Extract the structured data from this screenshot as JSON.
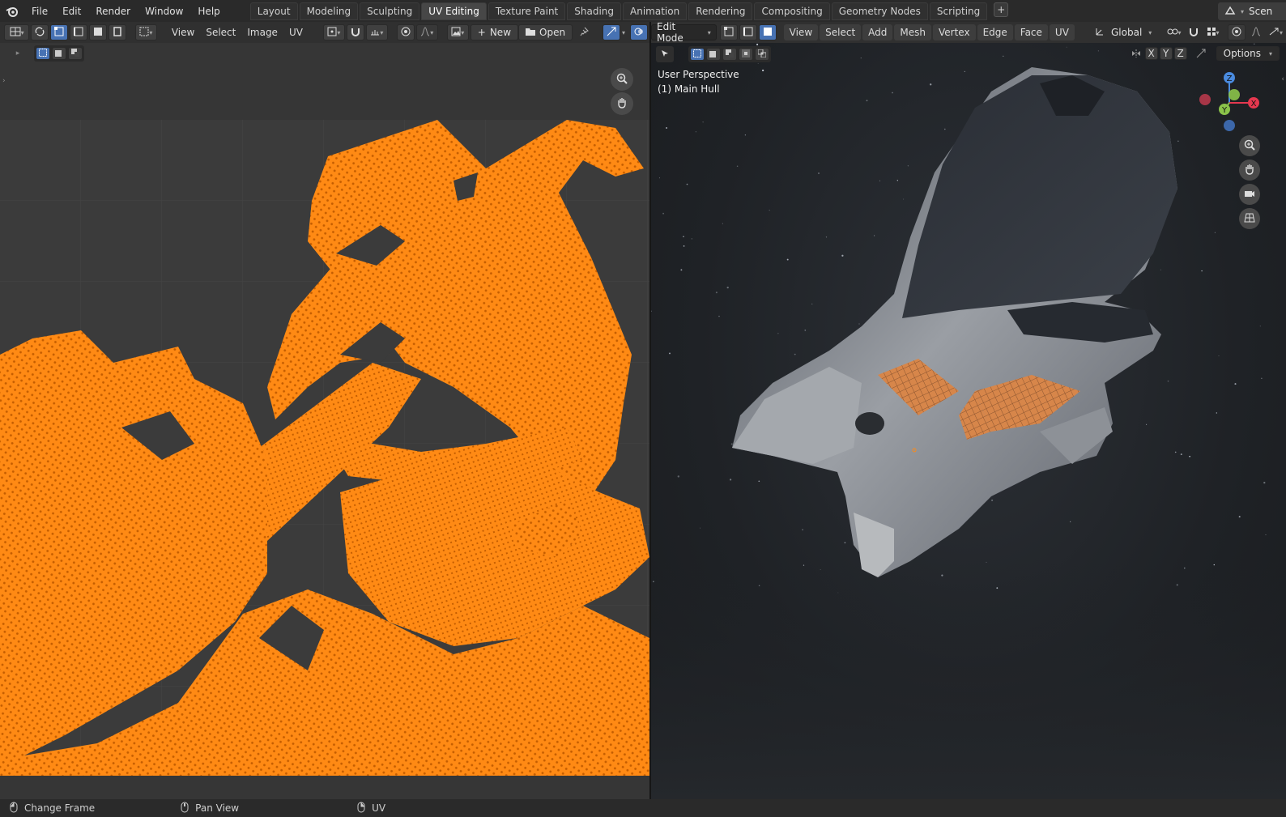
{
  "topbar": {
    "menus": [
      "File",
      "Edit",
      "Render",
      "Window",
      "Help"
    ],
    "tabs": [
      "Layout",
      "Modeling",
      "Sculpting",
      "UV Editing",
      "Texture Paint",
      "Shading",
      "Animation",
      "Rendering",
      "Compositing",
      "Geometry Nodes",
      "Scripting"
    ],
    "active_tab": "UV Editing",
    "scene_label": "Scen"
  },
  "uv_header": {
    "menus": [
      "View",
      "Select",
      "Image",
      "UV"
    ],
    "new_label": "New",
    "open_label": "Open"
  },
  "viewport_header": {
    "mode": "Edit Mode",
    "menus": [
      "View",
      "Select",
      "Add",
      "Mesh",
      "Vertex",
      "Edge",
      "Face",
      "UV"
    ],
    "orientation": "Global",
    "axis_x": "X",
    "axis_y": "Y",
    "axis_z": "Z",
    "options_label": "Options"
  },
  "viewport": {
    "perspective": "User Perspective",
    "object": "(1) Main Hull"
  },
  "gizmo": {
    "x": "X",
    "y": "Y",
    "z": "Z"
  },
  "statusbar": {
    "items": [
      "Change Frame",
      "Pan View",
      "UV"
    ]
  },
  "colors": {
    "uv_orange": "#ff8a14",
    "active_tab": "#474747",
    "select_blue": "#4772b3",
    "axis_x": "#e5384f",
    "axis_y": "#8bc34a",
    "axis_z": "#4a8be0"
  }
}
